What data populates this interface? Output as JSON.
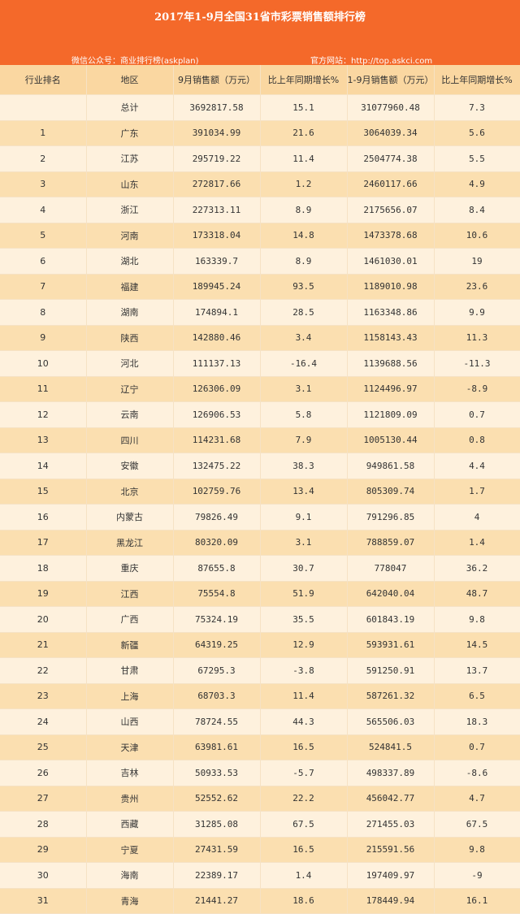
{
  "header": {
    "title": "2017年1-9月全国31省市彩票销售额排行榜",
    "wechat": "微信公众号：商业排行榜(askplan)",
    "website": "官方网站：http://top.askci.com"
  },
  "columns": [
    "行业排名",
    "地区",
    "9月销售额（万元）",
    "比上年同期增长%",
    "1-9月销售额（万元）",
    "比上年同期增长%"
  ],
  "rows": [
    [
      "",
      "总计",
      "3692817.58",
      "15.1",
      "31077960.48",
      "7.3"
    ],
    [
      "1",
      "广东",
      "391034.99",
      "21.6",
      "3064039.34",
      "5.6"
    ],
    [
      "2",
      "江苏",
      "295719.22",
      "11.4",
      "2504774.38",
      "5.5"
    ],
    [
      "3",
      "山东",
      "272817.66",
      "1.2",
      "2460117.66",
      "4.9"
    ],
    [
      "4",
      "浙江",
      "227313.11",
      "8.9",
      "2175656.07",
      "8.4"
    ],
    [
      "5",
      "河南",
      "173318.04",
      "14.8",
      "1473378.68",
      "10.6"
    ],
    [
      "6",
      "湖北",
      "163339.7",
      "8.9",
      "1461030.01",
      "19"
    ],
    [
      "7",
      "福建",
      "189945.24",
      "93.5",
      "1189010.98",
      "23.6"
    ],
    [
      "8",
      "湖南",
      "174894.1",
      "28.5",
      "1163348.86",
      "9.9"
    ],
    [
      "9",
      "陕西",
      "142880.46",
      "3.4",
      "1158143.43",
      "11.3"
    ],
    [
      "10",
      "河北",
      "111137.13",
      "-16.4",
      "1139688.56",
      "-11.3"
    ],
    [
      "11",
      "辽宁",
      "126306.09",
      "3.1",
      "1124496.97",
      "-8.9"
    ],
    [
      "12",
      "云南",
      "126906.53",
      "5.8",
      "1121809.09",
      "0.7"
    ],
    [
      "13",
      "四川",
      "114231.68",
      "7.9",
      "1005130.44",
      "0.8"
    ],
    [
      "14",
      "安徽",
      "132475.22",
      "38.3",
      "949861.58",
      "4.4"
    ],
    [
      "15",
      "北京",
      "102759.76",
      "13.4",
      "805309.74",
      "1.7"
    ],
    [
      "16",
      "内蒙古",
      "79826.49",
      "9.1",
      "791296.85",
      "4"
    ],
    [
      "17",
      "黑龙江",
      "80320.09",
      "3.1",
      "788859.07",
      "1.4"
    ],
    [
      "18",
      "重庆",
      "87655.8",
      "30.7",
      "778047",
      "36.2"
    ],
    [
      "19",
      "江西",
      "75554.8",
      "51.9",
      "642040.04",
      "48.7"
    ],
    [
      "20",
      "广西",
      "75324.19",
      "35.5",
      "601843.19",
      "9.8"
    ],
    [
      "21",
      "新疆",
      "64319.25",
      "12.9",
      "593931.61",
      "14.5"
    ],
    [
      "22",
      "甘肃",
      "67295.3",
      "-3.8",
      "591250.91",
      "13.7"
    ],
    [
      "23",
      "上海",
      "68703.3",
      "11.4",
      "587261.32",
      "6.5"
    ],
    [
      "24",
      "山西",
      "78724.55",
      "44.3",
      "565506.03",
      "18.3"
    ],
    [
      "25",
      "天津",
      "63981.61",
      "16.5",
      "524841.5",
      "0.7"
    ],
    [
      "26",
      "吉林",
      "50933.53",
      "-5.7",
      "498337.89",
      "-8.6"
    ],
    [
      "27",
      "贵州",
      "52552.62",
      "22.2",
      "456042.77",
      "4.7"
    ],
    [
      "28",
      "西藏",
      "31285.08",
      "67.5",
      "271455.03",
      "67.5"
    ],
    [
      "29",
      "宁夏",
      "27431.59",
      "16.5",
      "215591.56",
      "9.8"
    ],
    [
      "30",
      "海南",
      "22389.17",
      "1.4",
      "197409.97",
      "-9"
    ],
    [
      "31",
      "青海",
      "21441.27",
      "18.6",
      "178449.94",
      "16.1"
    ]
  ]
}
